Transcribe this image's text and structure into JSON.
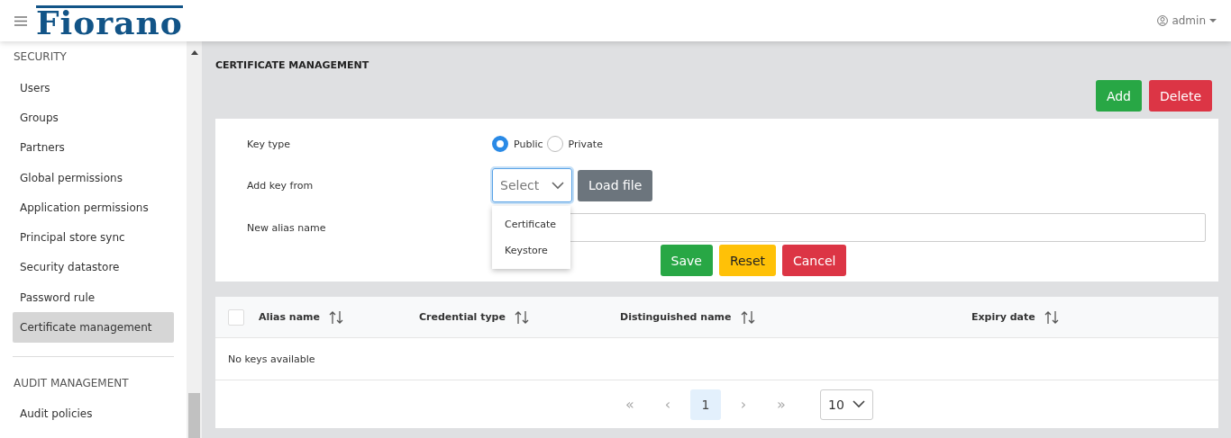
{
  "header": {
    "logo": "Fiorano",
    "user": "admin"
  },
  "sidebar": {
    "sections": [
      {
        "title": "SECURITY",
        "items": [
          {
            "label": "Users",
            "selected": false
          },
          {
            "label": "Groups",
            "selected": false
          },
          {
            "label": "Partners",
            "selected": false
          },
          {
            "label": "Global permissions",
            "selected": false
          },
          {
            "label": "Application permissions",
            "selected": false
          },
          {
            "label": "Principal store sync",
            "selected": false
          },
          {
            "label": "Security datastore",
            "selected": false
          },
          {
            "label": "Password rule",
            "selected": false
          },
          {
            "label": "Certificate management",
            "selected": true
          }
        ]
      },
      {
        "title": "AUDIT MANAGEMENT",
        "items": [
          {
            "label": "Audit policies",
            "selected": false
          }
        ]
      }
    ]
  },
  "page_title": "CERTIFICATE MANAGEMENT",
  "actions": [
    {
      "label": "Add",
      "kind": "success"
    },
    {
      "label": "Delete",
      "kind": "danger"
    }
  ],
  "form": {
    "key_type": {
      "label": "Key type",
      "options": [
        {
          "label": "Public",
          "selected": true
        },
        {
          "label": "Private",
          "selected": false
        }
      ]
    },
    "add_key_from": {
      "label": "Add key from",
      "placeholder": "Select",
      "expanded": true,
      "options": [
        "Certificate",
        "Keystore"
      ],
      "button": "Load file"
    },
    "alias": {
      "label": "New alias name"
    },
    "buttons": [
      {
        "label": "Save",
        "kind": "success"
      },
      {
        "label": "Reset",
        "kind": "warning"
      },
      {
        "label": "Cancel",
        "kind": "danger"
      }
    ]
  },
  "table": {
    "checked": false,
    "columns": [
      "Alias name",
      "Credential type",
      "Distinguished name",
      "Expiry date"
    ],
    "empty_text": "No keys available"
  },
  "pagination": {
    "first": "«",
    "prev": "‹",
    "page": "1",
    "next": "›",
    "last": "»",
    "page_size": "10"
  }
}
